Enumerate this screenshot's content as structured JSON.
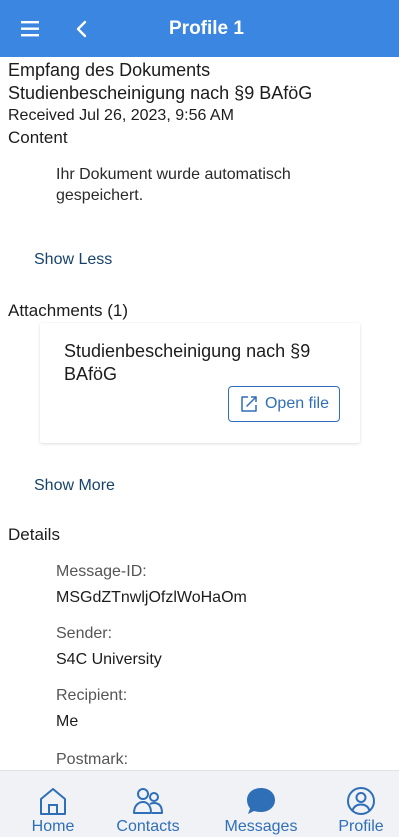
{
  "header": {
    "title": "Profile 1",
    "menu_icon": "hamburger-menu-icon",
    "back_icon": "chevron-left-icon",
    "bg_color": "#3a86e0"
  },
  "message": {
    "subject_line1": "Empfang des Dokuments",
    "subject_line2": "Studienbescheinigung nach §9 BAföG",
    "received": "Received Jul 26, 2023, 9:56 AM",
    "content_label": "Content",
    "content_line1": "Ihr Dokument wurde automatisch",
    "content_line2": "gespeichert.",
    "show_less": "Show Less"
  },
  "attachments": {
    "label": "Attachments (1)",
    "items": [
      {
        "name_line1": "Studienbescheinigung nach §9",
        "name_line2": "BAföG",
        "open_label": "Open file",
        "open_icon": "open-external-icon"
      }
    ],
    "show_more": "Show More"
  },
  "details": {
    "label": "Details",
    "fields": [
      {
        "key": "Message-ID:",
        "value": "MSGdZTnwljOfzlWoHaOm"
      },
      {
        "key": "Sender:",
        "value": "S4C University"
      },
      {
        "key": "Recipient:",
        "value": "Me"
      },
      {
        "key": "Postmark:",
        "value": ""
      }
    ]
  },
  "bottom_nav": {
    "items": [
      {
        "label": "Home",
        "icon": "home-icon"
      },
      {
        "label": "Contacts",
        "icon": "contacts-icon"
      },
      {
        "label": "Messages",
        "icon": "messages-icon"
      },
      {
        "label": "Profile",
        "icon": "profile-icon"
      }
    ],
    "active": "Messages",
    "accent_color": "#2f6fb8"
  }
}
